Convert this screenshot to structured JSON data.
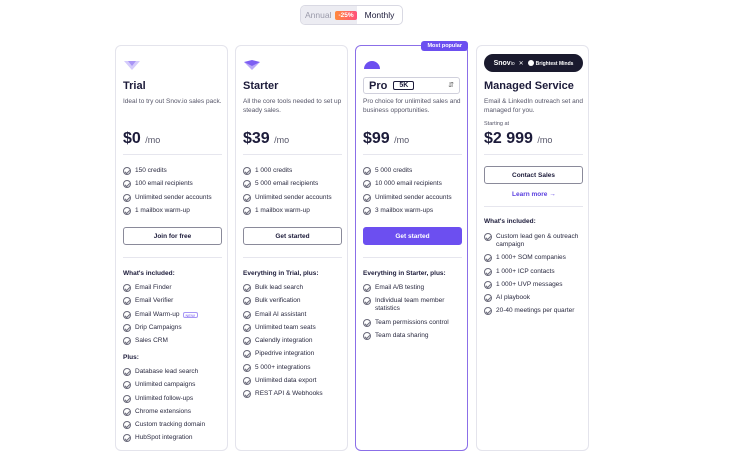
{
  "toggle": {
    "annual": "Annual",
    "discount": "-25%",
    "monthly": "Monthly"
  },
  "colors": {
    "accent": "#6c4ff0",
    "badge_gradient_start": "#ff8a3d",
    "badge_gradient_end": "#ff4f7a"
  },
  "cards": {
    "trial": {
      "title": "Trial",
      "description": "Ideal to try out Snov.io sales pack.",
      "price": "$0",
      "per": "/mo",
      "features": [
        "150 credits",
        "100 email recipients",
        "Unlimited sender accounts",
        "1 mailbox warm-up"
      ],
      "button": "Join for free",
      "included_heading": "What's included:",
      "included": [
        "Email Finder",
        "Email Verifier",
        "Email Warm-up",
        "Drip Campaigns",
        "Sales CRM"
      ],
      "new_badge": "NEW",
      "plus_heading": "Plus:",
      "plus": [
        "Database lead search",
        "Unlimited campaigns",
        "Unlimited follow-ups",
        "Chrome extensions",
        "Custom tracking domain",
        "HubSpot integration"
      ]
    },
    "starter": {
      "title": "Starter",
      "description": "All the core tools needed to set up steady sales.",
      "price": "$39",
      "per": "/mo",
      "features": [
        "1 000 credits",
        "5 000 email recipients",
        "Unlimited sender accounts",
        "1 mailbox warm-up"
      ],
      "button": "Get started",
      "included_heading": "Everything in Trial, plus:",
      "included": [
        "Bulk lead search",
        "Bulk verification",
        "Email AI assistant",
        "Unlimited team seats",
        "Calendly integration",
        "Pipedrive integration",
        "5 000+ integrations",
        "Unlimited data export",
        "REST API & Webhooks"
      ]
    },
    "pro": {
      "badge": "Most popular",
      "title": "Pro",
      "tier": "5K",
      "description": "Pro choice for unlimited sales and business opportunities.",
      "price": "$99",
      "per": "/mo",
      "features": [
        "5 000 credits",
        "10 000 email recipients",
        "Unlimited sender accounts",
        "3 mailbox warm-ups"
      ],
      "button": "Get started",
      "included_heading": "Everything in Starter, plus:",
      "included": [
        "Email A/B testing",
        "Individual team member statistics",
        "Team permissions control",
        "Team data sharing"
      ]
    },
    "managed": {
      "logo_left": "Snov",
      "logo_left_suffix": "io",
      "logo_right": "Brightest Minds",
      "title": "Managed Service",
      "description": "Email & LinkedIn outreach set and managed for you.",
      "starting_at": "Starting at",
      "price": "$2 999",
      "per": "/mo",
      "button": "Contact Sales",
      "learn_more": "Learn more →",
      "included_heading": "What's included:",
      "included": [
        "Custom lead gen & outreach campaign",
        "1 000+ SOM companies",
        "1 000+ ICP contacts",
        "1 000+ UVP messages",
        "AI playbook",
        "20-40 meetings per quarter"
      ]
    }
  }
}
